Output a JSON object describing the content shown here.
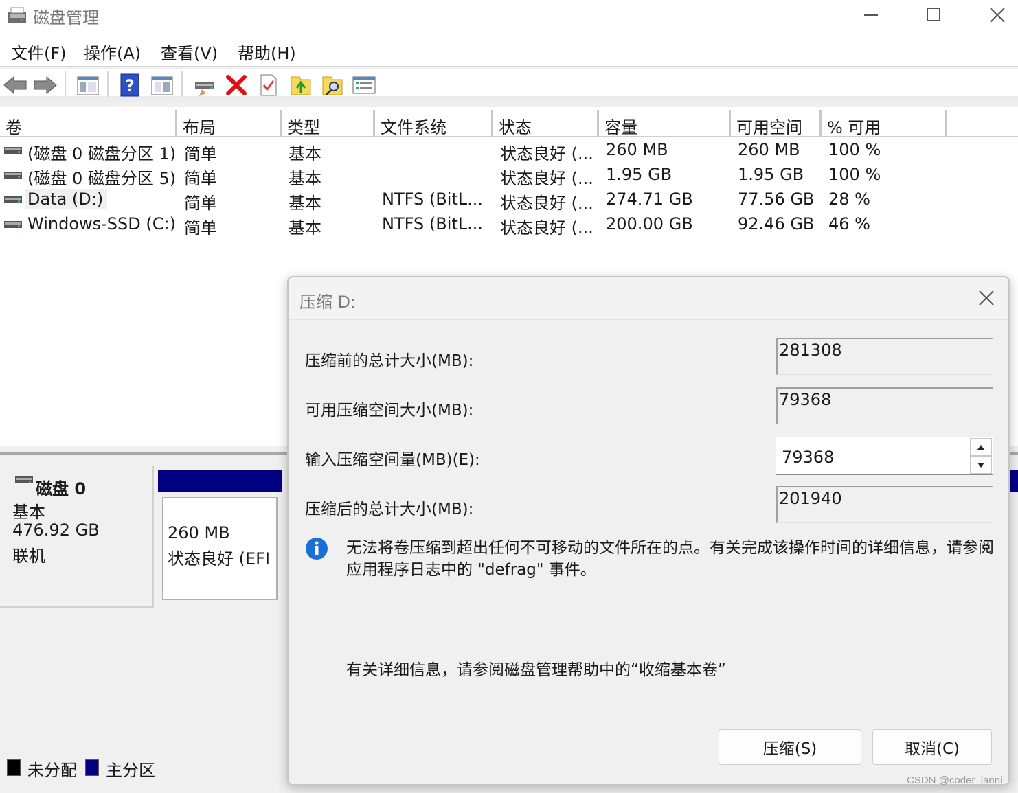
{
  "window": {
    "title": "磁盘管理"
  },
  "menu": [
    "文件(F)",
    "操作(A)",
    "查看(V)",
    "帮助(H)"
  ],
  "columns": [
    "卷",
    "布局",
    "类型",
    "文件系统",
    "状态",
    "容量",
    "可用空间",
    "% 可用"
  ],
  "volumes": [
    {
      "name": "(磁盘 0 磁盘分区 1)",
      "layout": "简单",
      "type": "基本",
      "fs": "",
      "status": "状态良好 (...",
      "capacity": "260 MB",
      "free": "260 MB",
      "pct": "100 %"
    },
    {
      "name": "(磁盘 0 磁盘分区 5)",
      "layout": "简单",
      "type": "基本",
      "fs": "",
      "status": "状态良好 (...",
      "capacity": "1.95 GB",
      "free": "1.95 GB",
      "pct": "100 %"
    },
    {
      "name": "Data (D:)",
      "layout": "简单",
      "type": "基本",
      "fs": "NTFS (BitL...",
      "status": "状态良好 (...",
      "capacity": "274.71 GB",
      "free": "77.56 GB",
      "pct": "28 %"
    },
    {
      "name": "Windows-SSD (C:)",
      "layout": "简单",
      "type": "基本",
      "fs": "NTFS (BitL...",
      "status": "状态良好 (...",
      "capacity": "200.00 GB",
      "free": "92.46 GB",
      "pct": "46 %"
    }
  ],
  "disk0": {
    "name": "磁盘 0",
    "type": "基本",
    "size": "476.92 GB",
    "state": "联机"
  },
  "partition1": {
    "size": "260 MB",
    "status": "状态良好 (EFI 系"
  },
  "legend": {
    "unallocated": "未分配",
    "primary": "主分区"
  },
  "colors": {
    "unallocated": "#000000",
    "primary": "#000080"
  },
  "dialog": {
    "title": "压缩 D:",
    "total_before_label": "压缩前的总计大小(MB):",
    "total_before_value": "281308",
    "available_label": "可用压缩空间大小(MB):",
    "available_value": "79368",
    "input_label": "输入压缩空间量(MB)(E):",
    "input_value": "79368",
    "total_after_label": "压缩后的总计大小(MB):",
    "total_after_value": "201940",
    "info_text": "无法将卷压缩到超出任何不可移动的文件所在的点。有关完成该操作时间的详细信息，请参阅应用程序日志中的 \"defrag\" 事件。",
    "help_text": "有关详细信息，请参阅磁盘管理帮助中的“收缩基本卷”",
    "shrink_button": "压缩(S)",
    "cancel_button": "取消(C)"
  },
  "watermark": "CSDN @coder_lanni"
}
